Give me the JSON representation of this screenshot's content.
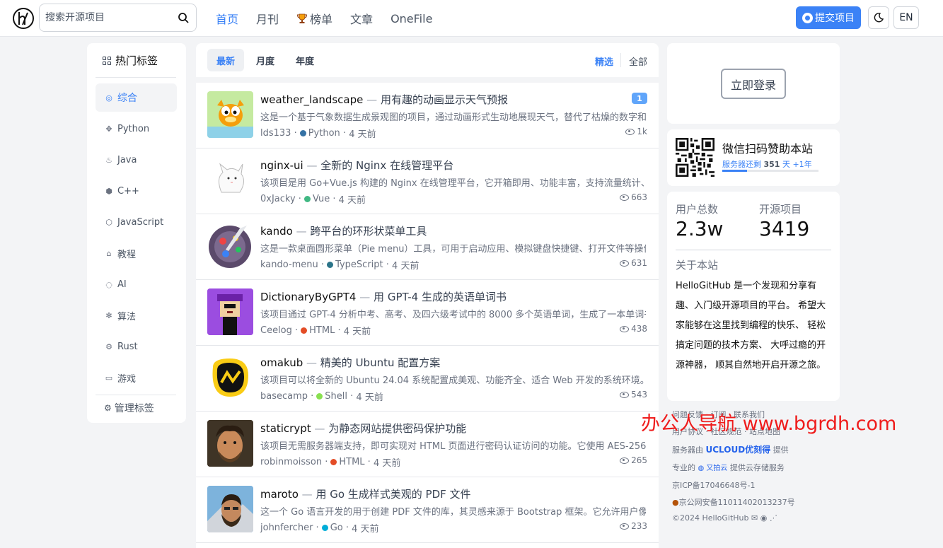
{
  "header": {
    "search_placeholder": "搜索开源项目",
    "nav": [
      {
        "label": "首页",
        "active": true
      },
      {
        "label": "月刊",
        "active": false
      },
      {
        "label": "榜单",
        "active": false,
        "icon": "trophy-icon"
      },
      {
        "label": "文章",
        "active": false
      },
      {
        "label": "OneFile",
        "active": false
      }
    ],
    "submit_label": "提交项目",
    "lang_label": "EN"
  },
  "sidebar": {
    "title": "热门标签",
    "tags": [
      {
        "label": "综合",
        "icon": "compass-icon",
        "active": true
      },
      {
        "label": "Python",
        "icon": "python-icon"
      },
      {
        "label": "Java",
        "icon": "java-icon"
      },
      {
        "label": "C++",
        "icon": "cpp-icon"
      },
      {
        "label": "JavaScript",
        "icon": "javascript-icon"
      },
      {
        "label": "教程",
        "icon": "graduation-cap-icon"
      },
      {
        "label": "AI",
        "icon": "ai-icon"
      },
      {
        "label": "算法",
        "icon": "algorithm-icon"
      },
      {
        "label": "Rust",
        "icon": "rust-icon"
      },
      {
        "label": "游戏",
        "icon": "gamepad-icon"
      }
    ],
    "manage_label": "管理标签"
  },
  "tabs": {
    "sort": [
      {
        "label": "最新",
        "active": true
      },
      {
        "label": "月度",
        "active": false
      },
      {
        "label": "年度",
        "active": false
      }
    ],
    "filter": [
      {
        "label": "精选",
        "active": true
      },
      {
        "label": "全部",
        "active": false
      }
    ]
  },
  "projects": [
    {
      "name": "weather_landscape",
      "title": "用有趣的动画显示天气预报",
      "desc": "这是一个基于气象数据生成景观图的项目，通过动画形式生动地展现天气，替代了枯燥的数字和图表。",
      "author": "lds133",
      "lang": "Python",
      "lang_color": "#3572A5",
      "time": "4 天前",
      "views": "1k",
      "badge": "1"
    },
    {
      "name": "nginx-ui",
      "title": "全新的 Nginx 在线管理平台",
      "desc": "该项目是用 Go+Vue.js 构建的 Nginx 在线管理平台，它开箱即用、功能丰富，支持流量统计、在线查看",
      "author": "0xJacky",
      "lang": "Vue",
      "lang_color": "#41b883",
      "time": "4 天前",
      "views": "663"
    },
    {
      "name": "kando",
      "title": "跨平台的环形状菜单工具",
      "desc": "这是一款桌面圆形菜单（Pie menu）工具，可用于启动应用、模拟键盘快捷键、打开文件等操作。",
      "author": "kando-menu",
      "lang": "TypeScript",
      "lang_color": "#2b7489",
      "time": "4 天前",
      "views": "631"
    },
    {
      "name": "DictionaryByGPT4",
      "title": "用 GPT-4 生成的英语单词书",
      "desc": "该项目通过 GPT-4 分析中考、高考、及四六级考试中的 8000 多个英语单词，生成了一本单词书。",
      "author": "Ceelog",
      "lang": "HTML",
      "lang_color": "#e34c26",
      "time": "4 天前",
      "views": "438"
    },
    {
      "name": "omakub",
      "title": "精美的 Ubuntu 配置方案",
      "desc": "该项目可以将全新的 Ubuntu 24.04 系统配置成美观、功能齐全、适合 Web 开发的系统环境。",
      "author": "basecamp",
      "lang": "Shell",
      "lang_color": "#89e051",
      "time": "4 天前",
      "views": "543"
    },
    {
      "name": "staticrypt",
      "title": "为静态网站提供密码保护功能",
      "desc": "该项目无需服务器端支持，即可实现对 HTML 页面进行密码认证访问的功能。它使用 AES-256 加密",
      "author": "robinmoisson",
      "lang": "HTML",
      "lang_color": "#e34c26",
      "time": "4 天前",
      "views": "265"
    },
    {
      "name": "maroto",
      "title": "用 Go 生成样式美观的 PDF 文件",
      "desc": "这一个 Go 语言开发的用于创建 PDF 文件的库，其灵感来源于 Bootstrap 框架。它允许用户像写",
      "author": "johnfercher",
      "lang": "Go",
      "lang_color": "#00ADD8",
      "time": "4 天前",
      "views": "233"
    }
  ],
  "right": {
    "login_label": "立即登录",
    "sponsor_title": "微信扫码赞助本站",
    "server_prefix": "服务器还剩",
    "server_days": "351",
    "server_suffix": "天",
    "server_plus": "+1年",
    "server_progress": 0.26,
    "stats": [
      {
        "label": "用户总数",
        "value": "2.3w"
      },
      {
        "label": "开源项目",
        "value": "3419"
      }
    ],
    "about_title": "关于本站",
    "about_text": "HelloGitHub 是一个发现和分享有趣、入门级开源项目的平台。 希望大家能够在这里找到编程的快乐、 轻松搞定问题的技术方案、 大呼过瘾的开源神器， 顺其自然地开启开源之旅。"
  },
  "footer": {
    "line1": "问题反馈 · 订阅 · 联系我们",
    "line2": "用户协议 · 社区规范 · 站点地图",
    "server_by_prefix": "服务器由",
    "server_by_brand": "UCLOUD优刻得",
    "server_by_suffix": "提供",
    "storage_prefix": "专业的",
    "storage_brand": "又拍云",
    "storage_suffix": "提供云存储服务",
    "icp": "京ICP备17046648号-1",
    "police": "京公网安备11011402013237号",
    "copyright": "©2024 HelloGitHub"
  },
  "watermark": "办公人导航 www.bgrdh.com",
  "colors": {
    "accent": "#3b82f6",
    "watermark": "#ef1c1c"
  }
}
